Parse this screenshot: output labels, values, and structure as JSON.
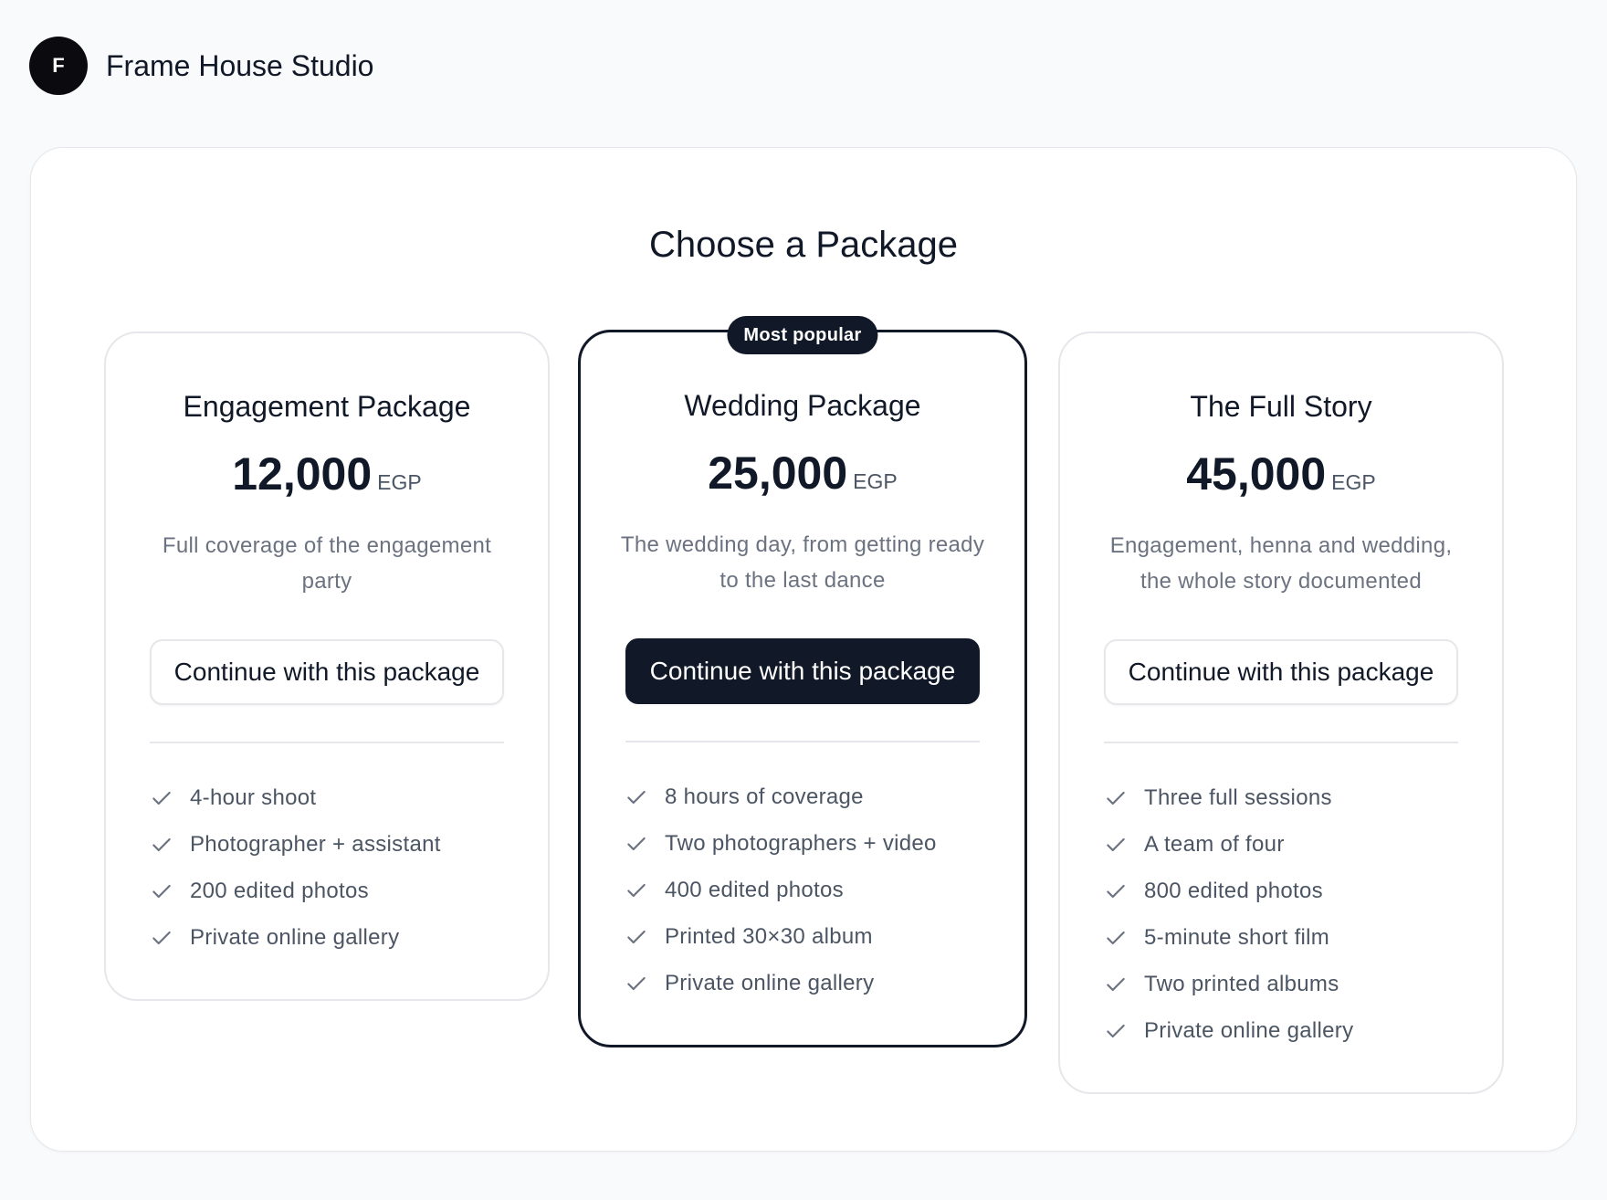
{
  "header": {
    "logo_letter": "F",
    "brand_name": "Frame House Studio"
  },
  "main": {
    "title": "Choose a Package",
    "packages": [
      {
        "name": "Engagement Package",
        "price": "12,000",
        "currency": "EGP",
        "description": "Full coverage of the engagement party",
        "cta_label": "Continue with this package",
        "featured": false,
        "features": [
          "4-hour shoot",
          "Photographer + assistant",
          "200 edited photos",
          "Private online gallery"
        ]
      },
      {
        "name": "Wedding Package",
        "badge": "Most popular",
        "price": "25,000",
        "currency": "EGP",
        "description": "The wedding day, from getting ready to the last dance",
        "cta_label": "Continue with this package",
        "featured": true,
        "features": [
          "8 hours of coverage",
          "Two photographers + video",
          "400 edited photos",
          "Printed 30×30 album",
          "Private online gallery"
        ]
      },
      {
        "name": "The Full Story",
        "price": "45,000",
        "currency": "EGP",
        "description": "Engagement, henna and wedding, the whole story documented",
        "cta_label": "Continue with this package",
        "featured": false,
        "features": [
          "Three full sessions",
          "A team of four",
          "800 edited photos",
          "5-minute short film",
          "Two printed albums",
          "Private online gallery"
        ]
      }
    ]
  },
  "icons": {
    "logo": "monogram-logo",
    "feature_bullet": "checkmark-icon"
  },
  "colors": {
    "primary": "#111827",
    "muted_text": "#6b7280",
    "border": "#e5e7eb",
    "background": "#f9fafb"
  }
}
